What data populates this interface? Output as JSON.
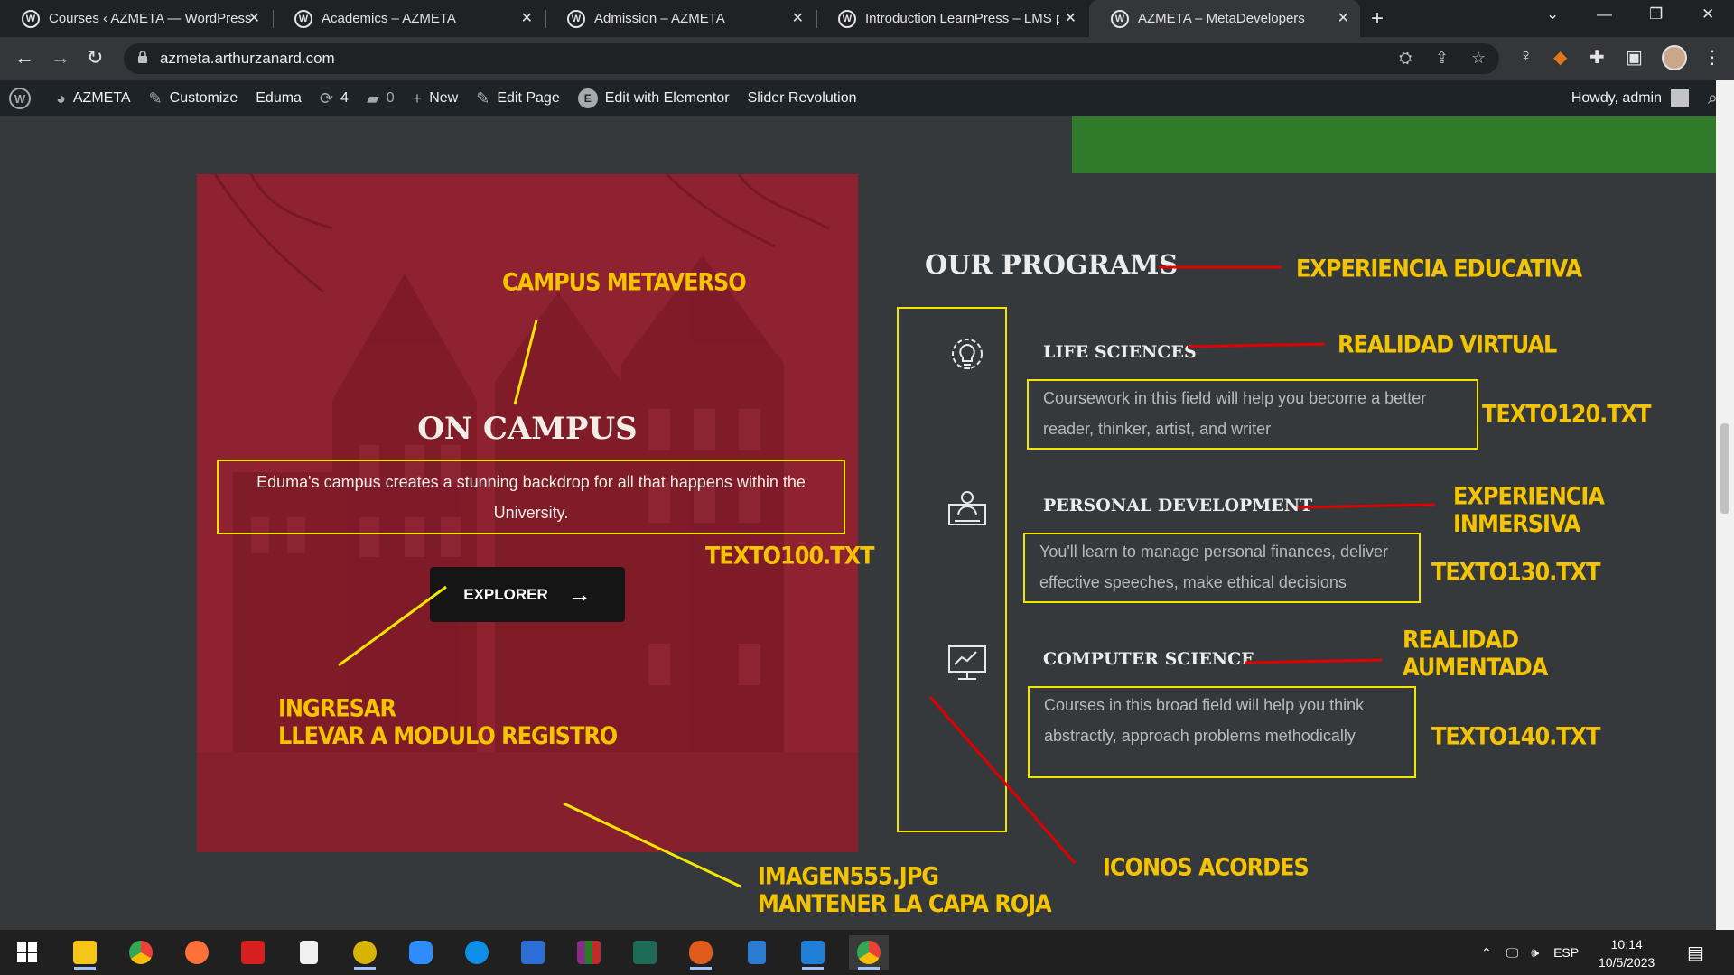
{
  "browser": {
    "tabs": [
      {
        "title": "Courses ‹ AZMETA — WordPress",
        "active": false
      },
      {
        "title": "Academics – AZMETA",
        "active": false
      },
      {
        "title": "Admission – AZMETA",
        "active": false
      },
      {
        "title": "Introduction LearnPress – LMS pl",
        "active": false
      },
      {
        "title": "AZMETA – MetaDevelopers",
        "active": true
      }
    ],
    "url": "azmeta.arthurzanard.com"
  },
  "admin_bar": {
    "site_name": "AZMETA",
    "customize": "Customize",
    "theme": "Eduma",
    "updates_count": "4",
    "comments_count": "0",
    "new_label": "New",
    "edit_page": "Edit Page",
    "elementor": "Edit with Elementor",
    "slider": "Slider Revolution",
    "howdy": "Howdy, admin"
  },
  "campus": {
    "title": "ON CAMPUS",
    "description": "Eduma's campus creates a stunning backdrop for all that happens within the University.",
    "button_label": "EXPLORER",
    "accent_color": "#8c1f2b"
  },
  "programs": {
    "heading": "OUR PROGRAMS",
    "items": [
      {
        "title": "LIFE SCIENCES",
        "description": "Coursework in this field will help you become a better reader, thinker, artist, and writer",
        "icon": "lightbulb-gear-icon"
      },
      {
        "title": "PERSONAL DEVELOPMENT",
        "description": "You'll learn to manage personal finances, deliver effective speeches, make ethical decisions",
        "icon": "presenter-icon"
      },
      {
        "title": "COMPUTER SCIENCE",
        "description": "Courses in this broad field will help you think abstractly, approach problems methodically",
        "icon": "monitor-chart-icon"
      }
    ]
  },
  "annotations": {
    "campus_metaverso": "CAMPUS METAVERSO",
    "experiencia_educativa": "EXPERIENCIA EDUCATIVA",
    "realidad_virtual": "REALIDAD VIRTUAL",
    "texto120": "TEXTO120.TXT",
    "experiencia_inmersiva_1": "EXPERIENCIA",
    "experiencia_inmersiva_2": "INMERSIVA",
    "texto130": "TEXTO130.TXT",
    "realidad_aumentada_1": "REALIDAD",
    "realidad_aumentada_2": "AUMENTADA",
    "texto140": "TEXTO140.TXT",
    "texto100": "TEXTO100.TXT",
    "ingresar_1": "INGRESAR",
    "ingresar_2": "LLEVAR A MODULO REGISTRO",
    "imagen_1": "IMAGEN555.JPG",
    "imagen_2": "MANTENER LA CAPA ROJA",
    "iconos": "ICONOS ACORDES",
    "color": "#f5c400"
  },
  "taskbar": {
    "language": "ESP",
    "time": "10:14",
    "date": "10/5/2023"
  }
}
